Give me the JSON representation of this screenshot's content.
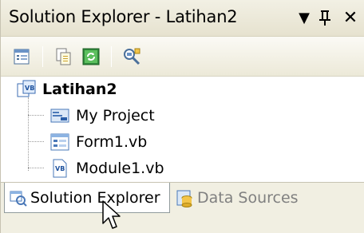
{
  "window": {
    "title": "Solution Explorer - Latihan2",
    "dropdown_glyph": "▼",
    "pin_glyph": "ㅍ",
    "close_glyph": "✕"
  },
  "toolbar": {
    "buttons": [
      {
        "icon": "properties-icon"
      },
      {
        "icon": "show-all-files-icon"
      },
      {
        "icon": "refresh-icon"
      },
      {
        "icon": "class-view-icon"
      }
    ]
  },
  "tree": {
    "root": {
      "label": "Latihan2",
      "icon": "vb-project-icon"
    },
    "children": [
      {
        "label": "My Project",
        "icon": "my-project-icon"
      },
      {
        "label": "Form1.vb",
        "icon": "form-icon"
      },
      {
        "label": "Module1.vb",
        "icon": "vb-module-icon"
      }
    ]
  },
  "tabs": [
    {
      "label": "Solution Explorer",
      "icon": "solution-explorer-icon",
      "active": true
    },
    {
      "label": "Data Sources",
      "icon": "data-sources-icon",
      "active": false
    }
  ],
  "colors": {
    "titlebar": "#ece9d8",
    "tab_strip": "#f1efe2",
    "inactive_tab_text": "#808080"
  }
}
